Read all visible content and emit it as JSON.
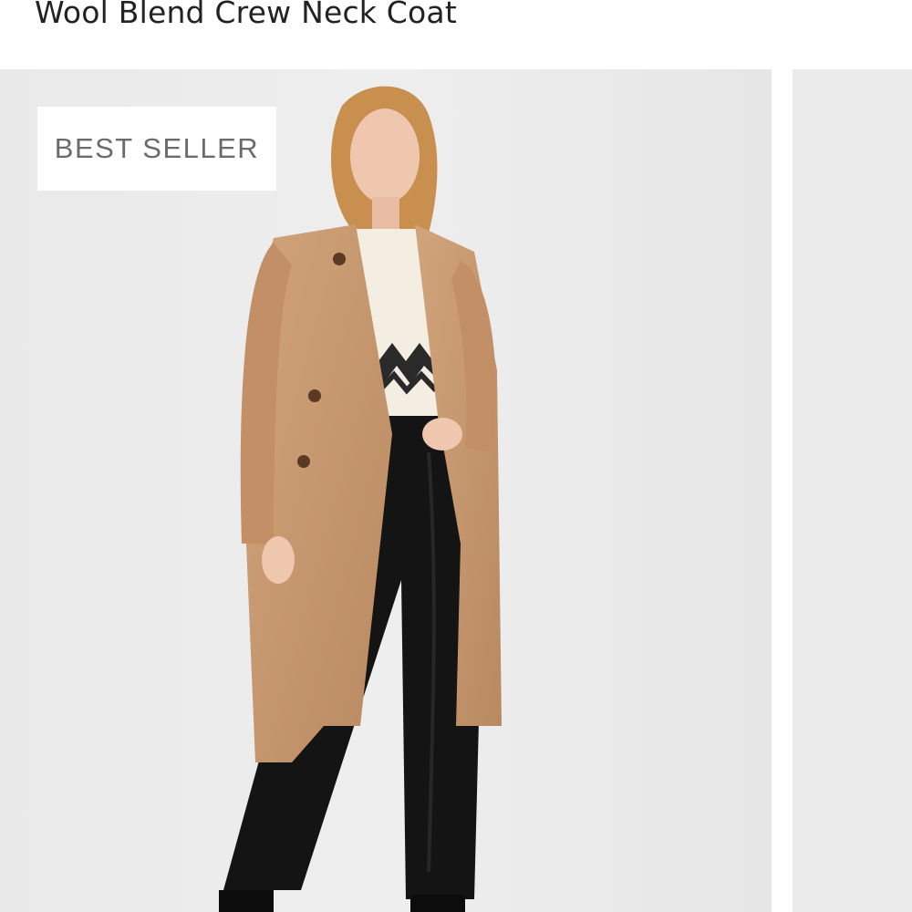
{
  "product": {
    "title": "Wool Blend Crew Neck Coat",
    "badge": "BEST SELLER"
  },
  "gallery": {
    "main_image": "model-wearing-camel-coat",
    "next_image": "product-image-partial"
  },
  "colors": {
    "background": "#ecebeb",
    "coat": "#c99a72",
    "pants": "#1a1a1a",
    "badge_text": "#6b6b6b"
  }
}
